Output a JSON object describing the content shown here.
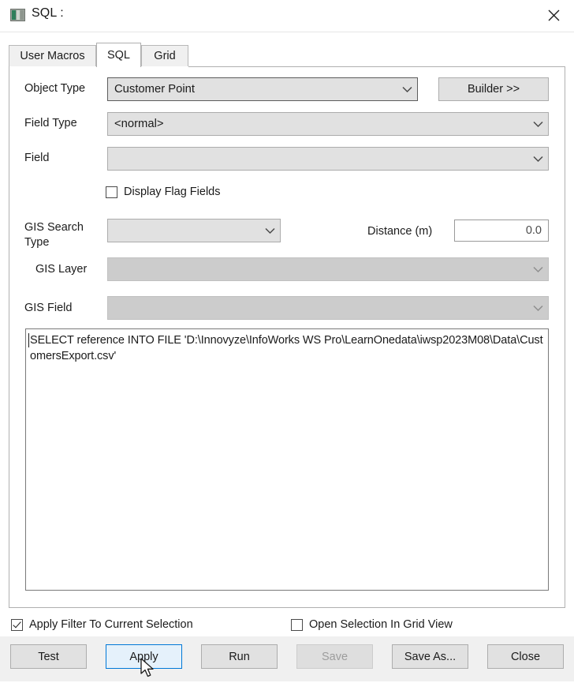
{
  "window": {
    "title": "SQL :",
    "icon": "sql-window-icon",
    "close_icon": "close-icon"
  },
  "tabs": [
    {
      "label": "User Macros",
      "active": false
    },
    {
      "label": "SQL",
      "active": true
    },
    {
      "label": "Grid",
      "active": false
    }
  ],
  "form": {
    "object_type": {
      "label": "Object Type",
      "value": "Customer Point",
      "enabled": true
    },
    "builder_button": {
      "label": "Builder >>"
    },
    "field_type": {
      "label": "Field Type",
      "value": "<normal>",
      "enabled": true
    },
    "field": {
      "label": "Field",
      "value": "",
      "enabled": true
    },
    "display_flag_fields": {
      "label": "Display Flag Fields",
      "checked": false
    },
    "gis_search_type": {
      "label": "GIS Search Type",
      "value": "",
      "enabled": true
    },
    "distance": {
      "label": "Distance (m)",
      "value": "0.0"
    },
    "gis_layer": {
      "label": "GIS Layer",
      "value": "",
      "enabled": false
    },
    "gis_field": {
      "label": "GIS Field",
      "value": "",
      "enabled": false
    }
  },
  "editor": {
    "sql": "SELECT reference INTO FILE 'D:\\Innovyze\\InfoWorks WS Pro\\LearnOnedata\\iwsp2023M08\\Data\\CustomersExport.csv'"
  },
  "options": {
    "apply_filter": {
      "label": "Apply Filter To Current Selection",
      "checked": true
    },
    "open_in_grid": {
      "label": "Open Selection In Grid View",
      "checked": false
    }
  },
  "buttons": {
    "test": {
      "label": "Test",
      "state": "normal"
    },
    "apply": {
      "label": "Apply",
      "state": "hover"
    },
    "run": {
      "label": "Run",
      "state": "normal"
    },
    "save": {
      "label": "Save",
      "state": "disabled"
    },
    "save_as": {
      "label": "Save As...",
      "state": "normal"
    },
    "close": {
      "label": "Close",
      "state": "normal"
    }
  },
  "colors": {
    "accent": "#0078d7",
    "hover_fill": "#e5f1fb",
    "control_face": "#e1e1e1",
    "disabled_face": "#cccccc",
    "window_bg": "#ffffff",
    "footer_bg": "#f0f0f0"
  }
}
